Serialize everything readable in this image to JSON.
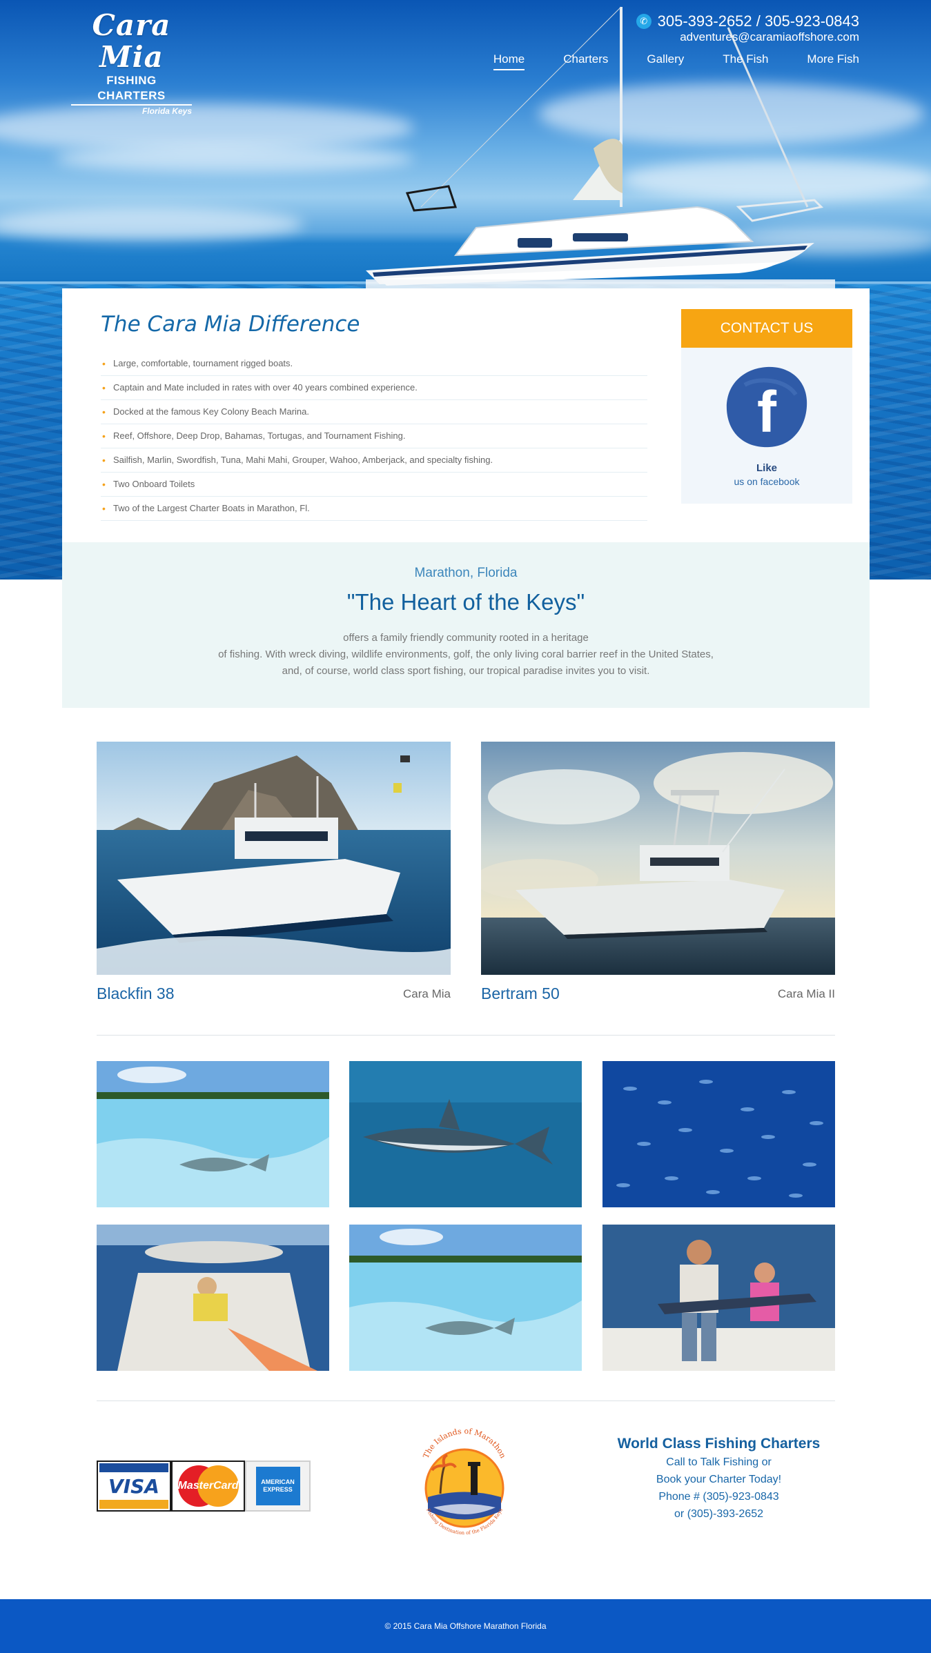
{
  "brand": {
    "name_line1": "Cara Mia",
    "name_line2": "FISHING CHARTERS",
    "name_line3": "Florida Keys"
  },
  "header": {
    "phones": "305-393-2652 / 305-923-0843",
    "email": "adventures@caramiaoffshore.com",
    "nav": [
      {
        "label": "Home",
        "active": true
      },
      {
        "label": "Charters",
        "active": false
      },
      {
        "label": "Gallery",
        "active": false
      },
      {
        "label": "The Fish",
        "active": false
      },
      {
        "label": "More Fish",
        "active": false
      }
    ]
  },
  "difference": {
    "title": "The Cara Mia Difference",
    "items": [
      "Large, comfortable, tournament rigged boats.",
      "Captain and Mate included in rates with over 40 years combined experience.",
      "Docked at the famous Key Colony Beach Marina.",
      "Reef, Offshore, Deep Drop, Bahamas, Tortugas, and Tournament Fishing.",
      "Sailfish, Marlin, Swordfish, Tuna, Mahi Mahi, Grouper, Wahoo, Amberjack, and specialty fishing.",
      "Two Onboard Toilets",
      "Two of the Largest Charter Boats in Marathon, Fl."
    ]
  },
  "contact": {
    "button": "CONTACT US",
    "fb_letter": "f",
    "like": "Like",
    "like_sub": "us on facebook"
  },
  "heart": {
    "subtitle": "Marathon, Florida",
    "title": "\"The Heart of the Keys\"",
    "lines": [
      "offers a family friendly community rooted in a heritage",
      "of fishing. With wreck diving, wildlife environments, golf, the only living coral barrier reef in the United States,",
      "and, of course, world class sport fishing, our tropical paradise invites you to visit."
    ]
  },
  "boats": [
    {
      "name": "Blackfin 38",
      "subtitle": "Cara Mia"
    },
    {
      "name": "Bertram 50",
      "subtitle": "Cara Mia II"
    }
  ],
  "payment_cards": [
    "VISA",
    "MasterCard",
    "AMERICAN EXPRESS"
  ],
  "marathon_logo": {
    "top_text": "The Islands of Marathon",
    "bottom_text": "Fishing Destination of the Florida Keys"
  },
  "world": {
    "heading": "World Class Fishing Charters",
    "lines": [
      "Call to Talk Fishing or",
      "Book your Charter Today!",
      "Phone # (305)-923-0843",
      "or (305)-393-2652"
    ]
  },
  "footer": {
    "copyright": "© 2015 Cara Mia Offshore Marathon Florida"
  },
  "colors": {
    "accent_orange": "#f7a512",
    "brand_blue": "#1468a8",
    "footer_blue": "#0b58c4",
    "band_bg": "#ecf6f6"
  }
}
